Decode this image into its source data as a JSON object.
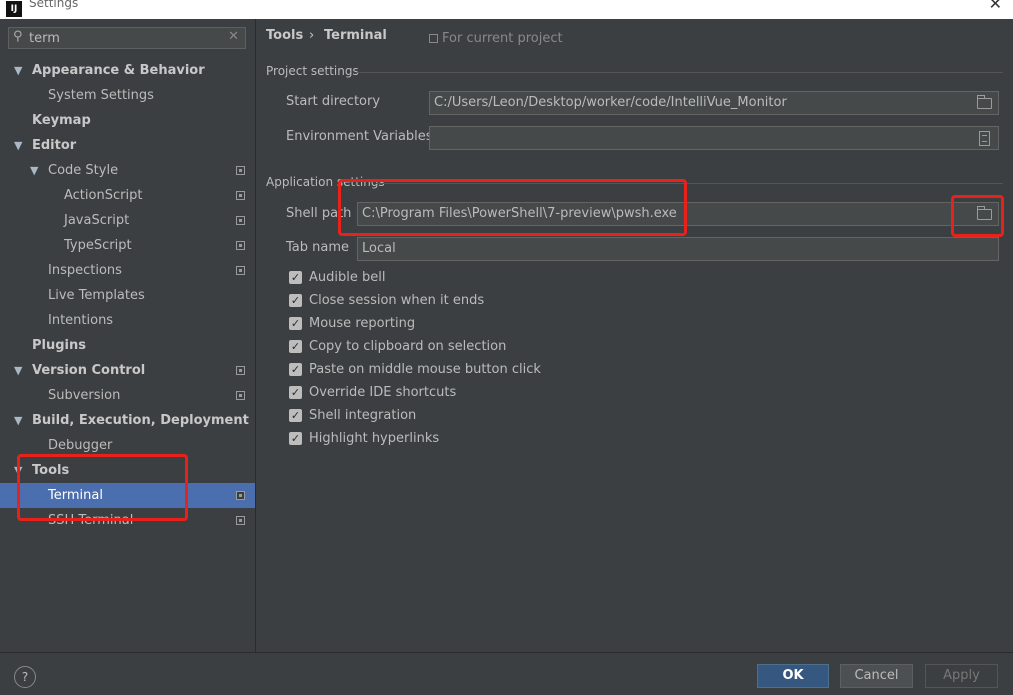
{
  "window": {
    "title": "Settings",
    "app_icon": "IJ"
  },
  "search": {
    "value": "term",
    "icon": "search-icon"
  },
  "tree": {
    "appearance": "Appearance & Behavior",
    "system_settings": "System Settings",
    "keymap": "Keymap",
    "editor": "Editor",
    "code_style": "Code Style",
    "actionscript": "ActionScript",
    "javascript": "JavaScript",
    "typescript": "TypeScript",
    "inspections": "Inspections",
    "live_templates": "Live Templates",
    "intentions": "Intentions",
    "plugins": "Plugins",
    "version_control": "Version Control",
    "subversion": "Subversion",
    "build": "Build, Execution, Deployment",
    "debugger": "Debugger",
    "tools": "Tools",
    "terminal": "Terminal",
    "ssh_terminal": "SSH Terminal"
  },
  "breadcrumb": {
    "parent": "Tools",
    "separator": "›",
    "current": "Terminal",
    "scope": "For current project"
  },
  "project_settings": {
    "title": "Project settings",
    "start_dir_label": "Start directory",
    "start_dir_value": "C:/Users/Leon/Desktop/worker/code/IntelliVue_Monitor",
    "env_label": "Environment Variables",
    "env_value": ""
  },
  "app_settings": {
    "title": "Application settings",
    "shell_label": "Shell path",
    "shell_value": "C:\\Program Files\\PowerShell\\7-preview\\pwsh.exe",
    "tab_label": "Tab name",
    "tab_value": "Local"
  },
  "checkboxes": [
    {
      "label": "Audible bell",
      "checked": true
    },
    {
      "label": "Close session when it ends",
      "checked": true
    },
    {
      "label": "Mouse reporting",
      "checked": true
    },
    {
      "label": "Copy to clipboard on selection",
      "checked": true
    },
    {
      "label": "Paste on middle mouse button click",
      "checked": true
    },
    {
      "label": "Override IDE shortcuts",
      "checked": true
    },
    {
      "label": "Shell integration",
      "checked": true
    },
    {
      "label": "Highlight hyperlinks",
      "checked": true
    }
  ],
  "footer": {
    "help": "?",
    "ok": "OK",
    "cancel": "Cancel",
    "apply": "Apply"
  },
  "colors": {
    "selection": "#4b6eaf",
    "annotation": "#e8211b",
    "primary_button": "#365880"
  }
}
